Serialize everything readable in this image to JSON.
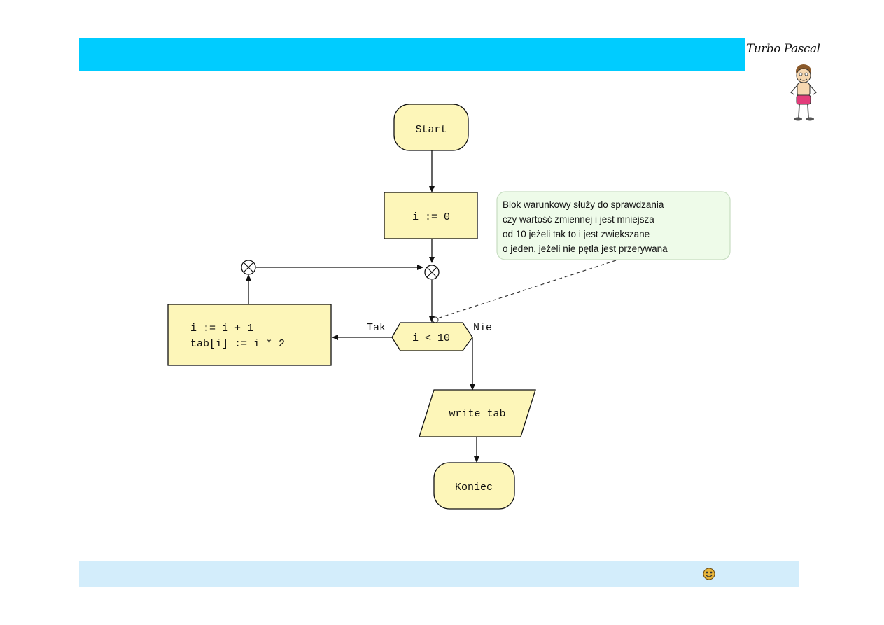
{
  "header": {
    "brand": "Turbo Pascal"
  },
  "flowchart": {
    "start": "Start",
    "init": "i := 0",
    "condition": "i < 10",
    "yes_label": "Tak",
    "no_label": "Nie",
    "loop_body": [
      "i := i + 1",
      "tab[i] := i * 2"
    ],
    "output": "write tab",
    "end": "Koniec"
  },
  "note": {
    "lines": [
      "Blok warunkowy służy do sprawdzania",
      "czy wartość zmiennej i jest mniejsza",
      "od 10 jeżeli tak to i jest zwiększane",
      "o jeden, jeżeli nie pętla jest przerywana"
    ]
  },
  "colors": {
    "header_bar": "#00ccff",
    "footer_bar": "#d3edfb",
    "block_fill": "#fdf6b9",
    "note_fill": "#eefbe9"
  },
  "icons": {
    "mascot": "cartoon-boy-icon",
    "footer": "smiley-icon"
  }
}
